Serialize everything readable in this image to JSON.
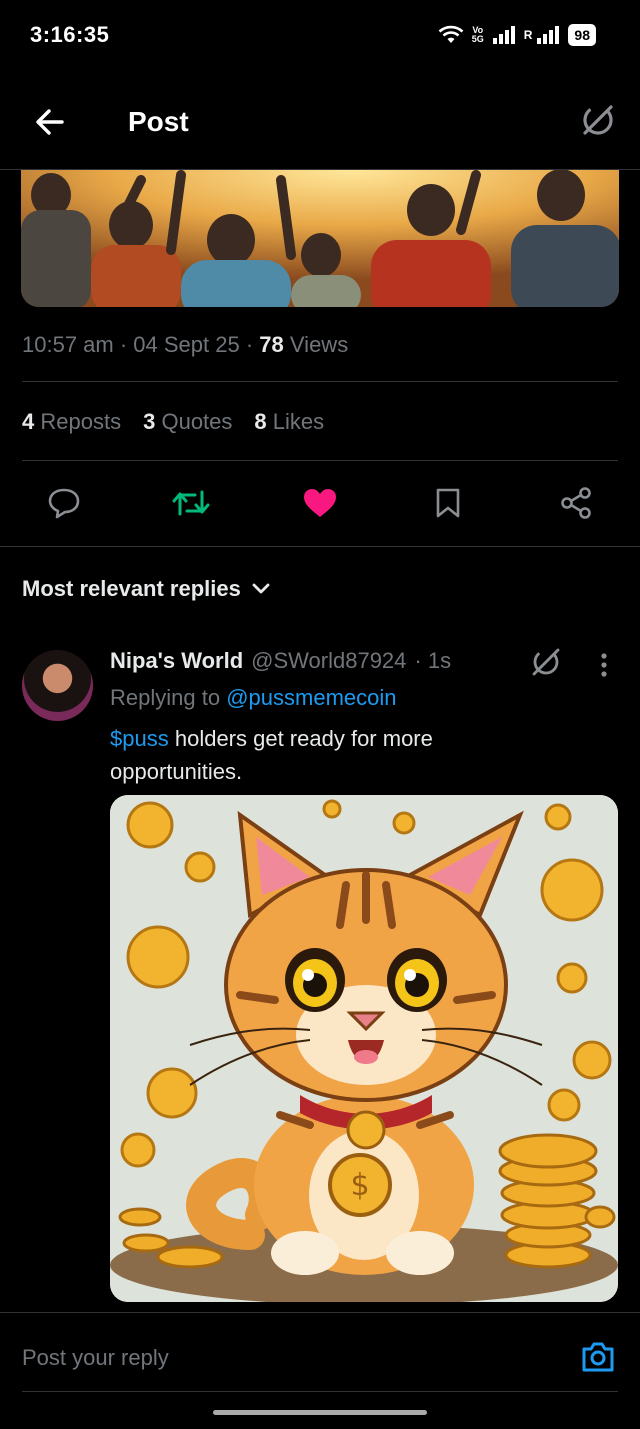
{
  "status_bar": {
    "time": "3:16:35",
    "volte_top": "Vo",
    "volte_bottom": "5G",
    "roaming": "R",
    "battery": "98"
  },
  "header": {
    "title": "Post",
    "back_icon": "arrow-left-icon",
    "grok_icon": "grok-icon"
  },
  "post": {
    "time": "10:57 am",
    "date": "04 Sept 25",
    "views_count": "78",
    "views_label": "Views",
    "reposts_count": "4",
    "reposts_label": "Reposts",
    "quotes_count": "3",
    "quotes_label": "Quotes",
    "likes_count": "8",
    "likes_label": "Likes",
    "liked": true,
    "reposted": true,
    "colors": {
      "repost": "#00ba7c",
      "like": "#f91880",
      "link": "#1d9bf0"
    }
  },
  "replies": {
    "sort_label": "Most relevant replies",
    "items": [
      {
        "name": "Nipa's World",
        "handle": "@SWorld87924",
        "time": "· 1s",
        "replying_prefix": "Replying to",
        "replying_to": "@pussmemecoin",
        "cashtag": "$puss",
        "text": "holders get ready for more opportunities."
      }
    ]
  },
  "composer": {
    "placeholder": "Post your reply",
    "camera_icon": "camera-icon"
  }
}
